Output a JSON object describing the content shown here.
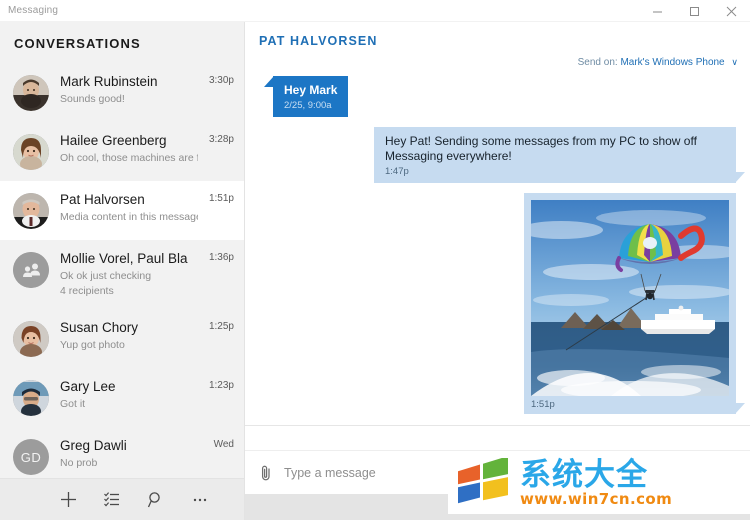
{
  "window": {
    "title": "Messaging",
    "minimize_label": "Minimize",
    "maximize_label": "Maximize",
    "close_label": "Close"
  },
  "sidebar": {
    "header": "Conversations",
    "conversations": [
      {
        "name": "Mark Rubinstein",
        "snippet": "Sounds good!",
        "time": "3:30p",
        "avatar": "photo-male-1",
        "selected": false,
        "extra": ""
      },
      {
        "name": "Hailee Greenberg",
        "snippet": "Oh cool, those machines are fun",
        "time": "3:28p",
        "avatar": "photo-female-1",
        "selected": false,
        "extra": ""
      },
      {
        "name": "Pat Halvorsen",
        "snippet": "Media content in this message",
        "time": "1:51p",
        "avatar": "photo-male-2",
        "selected": true,
        "extra": ""
      },
      {
        "name": "Mollie Vorel, Paul Bla",
        "snippet": "Ok ok just checking",
        "time": "1:36p",
        "avatar": "group-people-icon",
        "selected": false,
        "extra": "4 recipients"
      },
      {
        "name": "Susan Chory",
        "snippet": "Yup got photo",
        "time": "1:25p",
        "avatar": "photo-female-2",
        "selected": false,
        "extra": ""
      },
      {
        "name": "Gary Lee",
        "snippet": "Got it",
        "time": "1:23p",
        "avatar": "photo-male-3",
        "selected": false,
        "extra": ""
      },
      {
        "name": "Greg Dawli",
        "snippet": "No prob",
        "time": "Wed",
        "avatar": "initials",
        "initials": "GD",
        "selected": false,
        "extra": ""
      }
    ],
    "toolbar": [
      {
        "icon": "plus-icon",
        "label": "New message"
      },
      {
        "icon": "select-list-icon",
        "label": "Select"
      },
      {
        "icon": "search-icon",
        "label": "Search"
      },
      {
        "icon": "more-ellipsis-icon",
        "label": "More"
      }
    ]
  },
  "thread": {
    "title": "Pat Halvorsen",
    "send_on_label": "Send on:",
    "send_on_device": "Mark's Windows Phone",
    "send_on_chevron": "∨",
    "messages": [
      {
        "direction": "in",
        "text": "Hey Mark",
        "timestamp": "2/25, 9:00a",
        "kind": "text"
      },
      {
        "direction": "out",
        "text": "Hey Pat! Sending some messages from my PC to show off Messaging everywhere!",
        "timestamp": "1:47p",
        "kind": "text"
      },
      {
        "direction": "out",
        "text": "",
        "timestamp": "1:51p",
        "kind": "photo",
        "photo_alt": "Parasailing over the ocean with a cruise ship and rock formations"
      }
    ]
  },
  "compose": {
    "attach_icon": "paperclip-icon",
    "placeholder": "Type a message",
    "value": "",
    "emoji_icon": "emoji-smiley-icon"
  },
  "watermark": {
    "brand": "系统大全",
    "url": "www.win7cn.com",
    "logo": "windows-flag-logo"
  },
  "colors": {
    "accent_blue": "#1f6fb5",
    "bubble_in": "#1c76c5",
    "bubble_out": "#c6dbf0",
    "sidebar_bg": "#f2f2f2",
    "watermark_brand": "#2aa7e8",
    "watermark_url": "#f08a12"
  }
}
